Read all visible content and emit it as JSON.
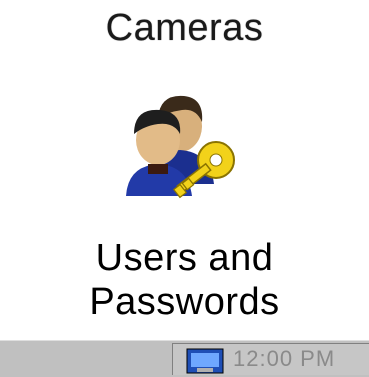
{
  "desktop": {
    "icons": [
      {
        "label": "Cameras"
      },
      {
        "label_line1": "Users and",
        "label_line2": "Passwords",
        "icon": "users-key-icon"
      }
    ]
  },
  "taskbar": {
    "tray": {
      "icon": "monitor-icon",
      "text": "12:00 PM"
    }
  },
  "colors": {
    "desktop_bg": "#ffffff",
    "taskbar_bg": "#c0c0c0",
    "key_yellow": "#f2d21a"
  }
}
